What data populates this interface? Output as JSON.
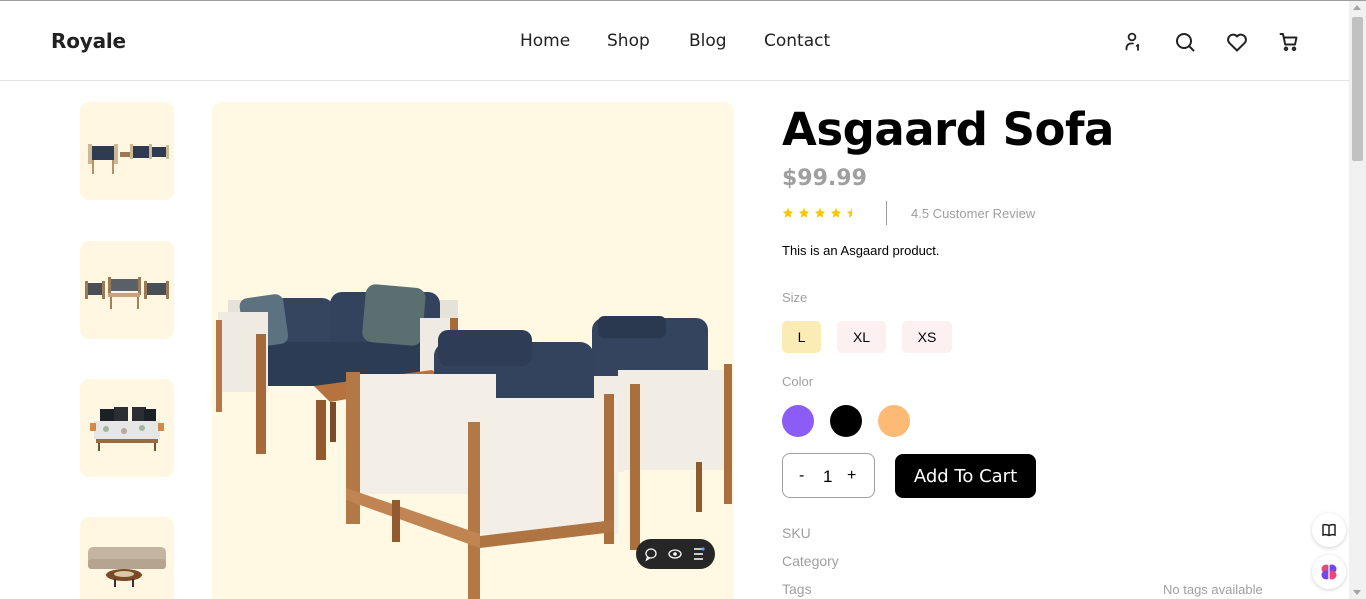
{
  "header": {
    "logo": "Royale",
    "nav": [
      {
        "label": "Home"
      },
      {
        "label": "Shop"
      },
      {
        "label": "Blog"
      },
      {
        "label": "Contact"
      }
    ],
    "icons": [
      "user-icon",
      "search-icon",
      "heart-icon",
      "cart-icon"
    ]
  },
  "gallery": {
    "thumbnail_icons": [
      "sofa-set-thumbnail",
      "outdoor-set-thumbnail",
      "floral-sofa-thumbnail",
      "beige-sofa-thumbnail"
    ],
    "main_image_icon": "asgaard-sofa-image",
    "floating_tool_icons": [
      "comment-icon",
      "eye-icon",
      "menu-icon"
    ]
  },
  "product": {
    "title": "Asgaard Sofa",
    "price": "$99.99",
    "rating": 4.5,
    "rating_max": 5,
    "review_text": "4.5 Customer Review",
    "description": "This is an Asgaard product.",
    "size_label": "Size",
    "sizes": [
      {
        "label": "L",
        "selected": true
      },
      {
        "label": "XL",
        "selected": false
      },
      {
        "label": "XS",
        "selected": false
      }
    ],
    "color_label": "Color",
    "colors": [
      "#8b5cf6",
      "#000000",
      "#fdba74"
    ],
    "quantity": {
      "minus": "-",
      "value": "1",
      "plus": "+"
    },
    "add_to_cart": "Add To Cart",
    "meta": {
      "sku_label": "SKU",
      "category_label": "Category",
      "tags_label": "Tags",
      "tags_value": "No tags available"
    }
  },
  "theme": {
    "accent_bg": "#fff8e3",
    "selected_size_bg": "#f9f1e7",
    "unselected_size_bg": "#fdf0f0",
    "star_color": "#ffc700",
    "muted_text": "#9f9f9f"
  }
}
